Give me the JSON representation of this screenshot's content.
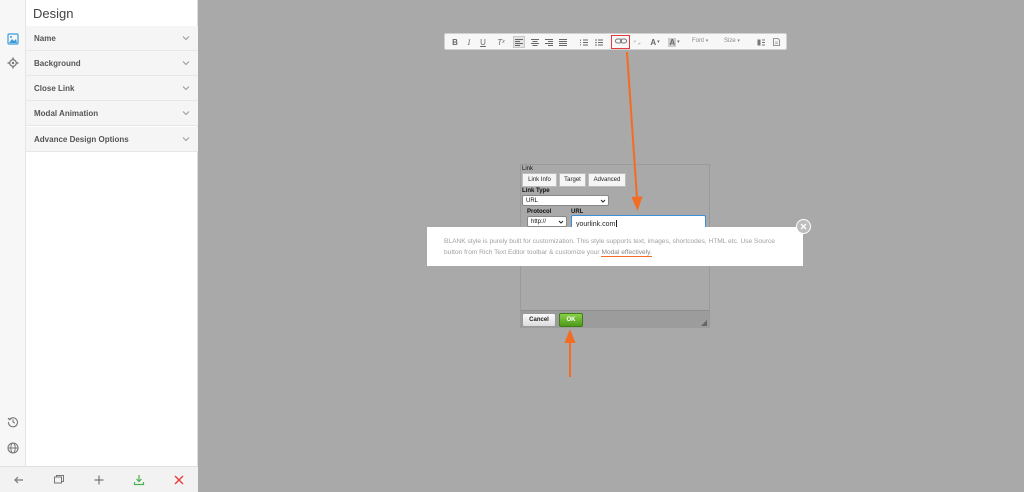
{
  "panel": {
    "title": "Design",
    "sections": [
      {
        "label": "Name"
      },
      {
        "label": "Background"
      },
      {
        "label": "Close Link"
      },
      {
        "label": "Modal Animation"
      },
      {
        "label": "Advance Design Options"
      }
    ]
  },
  "rail": {
    "icons": [
      "image-icon",
      "gear-icon",
      "history-icon",
      "globe-icon"
    ]
  },
  "bottom_bar": {
    "buttons": [
      "back-arrow-icon",
      "preview-icon",
      "plus-icon",
      "download-icon",
      "close-x-icon"
    ]
  },
  "toolbar": {
    "font_label": "Font",
    "size_label": "Size"
  },
  "link_dialog": {
    "title": "Link",
    "tabs": [
      "Link Info",
      "Target",
      "Advanced"
    ],
    "link_type_label": "Link Type",
    "link_type_value": "URL",
    "protocol_label": "Protocol",
    "protocol_value": "http://",
    "url_label": "URL",
    "url_value": "yourlink.com",
    "cancel_label": "Cancel",
    "ok_label": "OK"
  },
  "banner": {
    "text": "BLANK style is purely built for customization. This style supports text, images, shortcodes, HTML etc. Use Source button from Rich Text Editor toolbar & customize your ",
    "link_text": "Modal effectively."
  },
  "colors": {
    "canvas_bg": "#a9a9a9",
    "annotation_arrow": "#f36c21",
    "highlight_box": "#e53a3a",
    "ok_green": "#5da91f",
    "input_focus": "#3b8ed8"
  }
}
